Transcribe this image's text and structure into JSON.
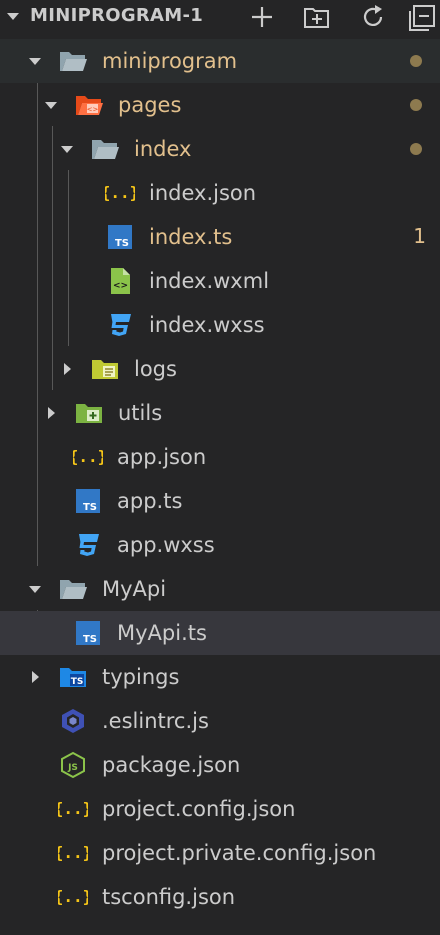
{
  "explorer": {
    "title": "MINIPROGRAM-1",
    "actions": [
      "new-file-icon",
      "new-folder-icon",
      "refresh-icon"
    ]
  },
  "tree": [
    {
      "label": "miniprogram",
      "icon": "folder-open-icon",
      "expanded": true,
      "modified": true,
      "badge": "dot"
    },
    {
      "label": "pages",
      "icon": "pages-folder-open-icon",
      "expanded": true,
      "modified": true,
      "badge": "dot"
    },
    {
      "label": "index",
      "icon": "folder-open-icon",
      "expanded": true,
      "modified": true,
      "badge": "dot"
    },
    {
      "label": "index.json",
      "icon": "json-braces-icon",
      "modified": false
    },
    {
      "label": "index.ts",
      "icon": "typescript-file-icon",
      "modified": true,
      "badge": "1"
    },
    {
      "label": "index.wxml",
      "icon": "wxml-file-icon",
      "modified": false
    },
    {
      "label": "index.wxss",
      "icon": "css3-file-icon",
      "modified": false
    },
    {
      "label": "logs",
      "icon": "logs-folder-icon",
      "expanded": false,
      "modified": false
    },
    {
      "label": "utils",
      "icon": "utils-folder-icon",
      "expanded": false,
      "modified": false
    },
    {
      "label": "app.json",
      "icon": "json-braces-icon",
      "modified": false
    },
    {
      "label": "app.ts",
      "icon": "typescript-file-icon",
      "modified": false
    },
    {
      "label": "app.wxss",
      "icon": "css3-file-icon",
      "modified": false
    },
    {
      "label": "MyApi",
      "icon": "folder-open-icon",
      "expanded": true,
      "modified": false
    },
    {
      "label": "MyApi.ts",
      "icon": "typescript-file-icon",
      "modified": false,
      "selected": true
    },
    {
      "label": "typings",
      "icon": "typings-folder-icon",
      "expanded": false,
      "modified": false
    },
    {
      "label": ".eslintrc.js",
      "icon": "eslint-icon",
      "modified": false
    },
    {
      "label": "package.json",
      "icon": "nodejs-icon",
      "modified": false
    },
    {
      "label": "project.config.json",
      "icon": "json-braces-icon",
      "modified": false
    },
    {
      "label": "project.private.config.json",
      "icon": "json-braces-icon",
      "modified": false
    },
    {
      "label": "tsconfig.json",
      "icon": "json-braces-icon",
      "modified": false
    }
  ],
  "colors": {
    "background": "#252526",
    "modified_text": "#e2c08d",
    "selected_row": "#37373d",
    "typescript": "#3178c6",
    "css3": "#42a5f5",
    "json": "#f5c518"
  }
}
